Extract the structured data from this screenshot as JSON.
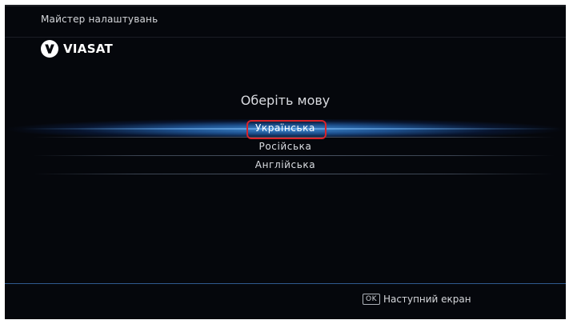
{
  "header": {
    "wizard_title": "Майстер налаштувань",
    "brand": "VIASAT"
  },
  "main": {
    "prompt": "Оберіть мову",
    "languages": [
      {
        "label": "Українська",
        "selected": true
      },
      {
        "label": "Російська",
        "selected": false
      },
      {
        "label": "Англійська",
        "selected": false
      }
    ]
  },
  "footer": {
    "ok_key": "OK",
    "next_label": "Наступний екран"
  },
  "colors": {
    "background": "#05070c",
    "highlight": "#3f8ad0",
    "selection_outline": "#d8232a"
  },
  "icons": {
    "logo": "viasat-logo-icon"
  }
}
